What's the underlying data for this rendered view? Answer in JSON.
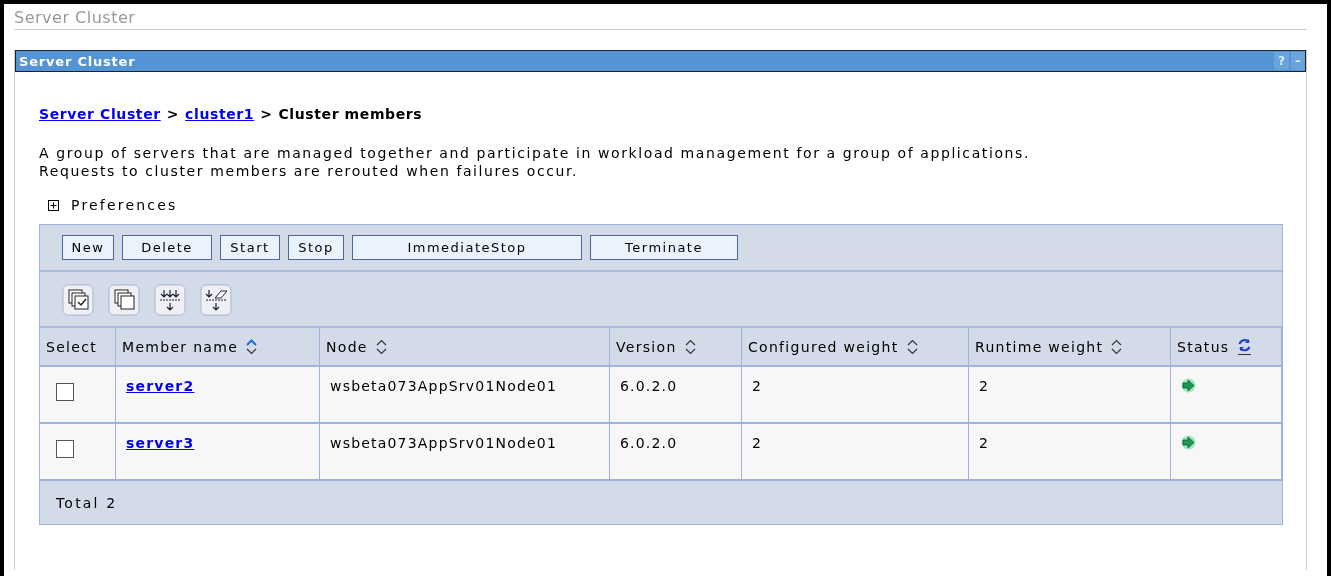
{
  "page_title": "Server Cluster",
  "panel": {
    "title": "Server Cluster",
    "help": "?",
    "minimize": "–"
  },
  "breadcrumb": [
    {
      "label": "Server Cluster",
      "kind": "link"
    },
    {
      "label": "cluster1",
      "kind": "link"
    },
    {
      "label": "Cluster members",
      "kind": "current"
    }
  ],
  "separator": ">",
  "description": [
    "A group of servers that are managed together and participate in workload management for a group of applications.",
    "Requests to cluster members are rerouted when failures occur."
  ],
  "preferences": {
    "label": "Preferences",
    "expanded": false
  },
  "buttons": [
    {
      "label": "New"
    },
    {
      "label": "Delete"
    },
    {
      "label": "Start"
    },
    {
      "label": "Stop"
    },
    {
      "label": "ImmediateStop"
    },
    {
      "label": "Terminate"
    }
  ],
  "tool_icons": [
    {
      "kind": "select-all"
    },
    {
      "kind": "deselect-all"
    },
    {
      "kind": "filter"
    },
    {
      "kind": "clear-filter"
    }
  ],
  "table": {
    "columns": [
      {
        "label": "Select",
        "kind": "plain"
      },
      {
        "label": "Member name",
        "kind": "sort-asc"
      },
      {
        "label": "Node",
        "kind": "sort"
      },
      {
        "label": "Version",
        "kind": "sort"
      },
      {
        "label": "Configured weight",
        "kind": "sort"
      },
      {
        "label": "Runtime weight",
        "kind": "sort"
      },
      {
        "label": "Status",
        "kind": "refresh"
      }
    ],
    "rows": [
      {
        "checked": false,
        "member": "server2",
        "node": "wsbeta073AppSrv01Node01",
        "version": "6.0.2.0",
        "configured_weight": "2",
        "runtime_weight": "2",
        "running": true
      },
      {
        "checked": false,
        "member": "server3",
        "node": "wsbeta073AppSrv01Node01",
        "version": "6.0.2.0",
        "configured_weight": "2",
        "runtime_weight": "2",
        "running": true
      }
    ],
    "total": "Total 2"
  }
}
